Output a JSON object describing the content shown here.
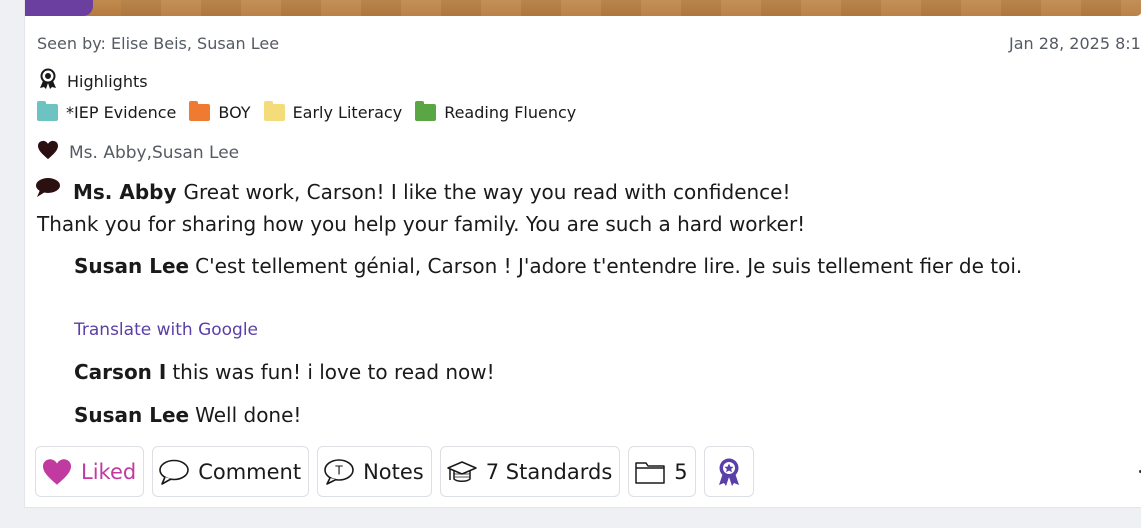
{
  "post": {
    "seen_by": "Seen by: Elise Beis, Susan Lee",
    "date": "Jan 28, 2025 8:1",
    "highlights_label": "Highlights",
    "folders": [
      {
        "label": "*IEP Evidence",
        "color": "#6cc3c0"
      },
      {
        "label": "BOY",
        "color": "#ef7a32"
      },
      {
        "label": "Early Literacy",
        "color": "#f5dc7a"
      },
      {
        "label": "Reading Fluency",
        "color": "#5aa544"
      }
    ],
    "liked_by": "Ms. Abby,Susan Lee",
    "comments": [
      {
        "author": "Ms. Abby",
        "text_line1": "Great work, Carson! I like the way you read with confidence!",
        "text_line2": "Thank you for sharing how you help your family. You are such a hard worker!"
      }
    ],
    "replies": [
      {
        "author": "Susan Lee",
        "text": "C'est tellement génial, Carson ! J'adore t'entendre lire. Je suis tellement fier de toi."
      },
      {
        "author": "Carson I",
        "text": "this was fun! i love to read now!"
      },
      {
        "author": "Susan Lee",
        "text": "Well done!"
      }
    ],
    "translate_link": "Translate with Google"
  },
  "actions": {
    "liked_label": "Liked",
    "comment_label": "Comment",
    "notes_label": "Notes",
    "standards_label": "7 Standards",
    "folders_count": "5"
  },
  "colors": {
    "accent_purple": "#5a3fa8",
    "liked_pink": "#c03aa0",
    "text_secondary": "#555a63"
  },
  "icons": [
    "highlights-ribbon-icon",
    "folder-icon",
    "heart-icon",
    "speech-bubble-icon",
    "graduation-cap-icon",
    "award-badge-icon",
    "notes-t-icon"
  ]
}
